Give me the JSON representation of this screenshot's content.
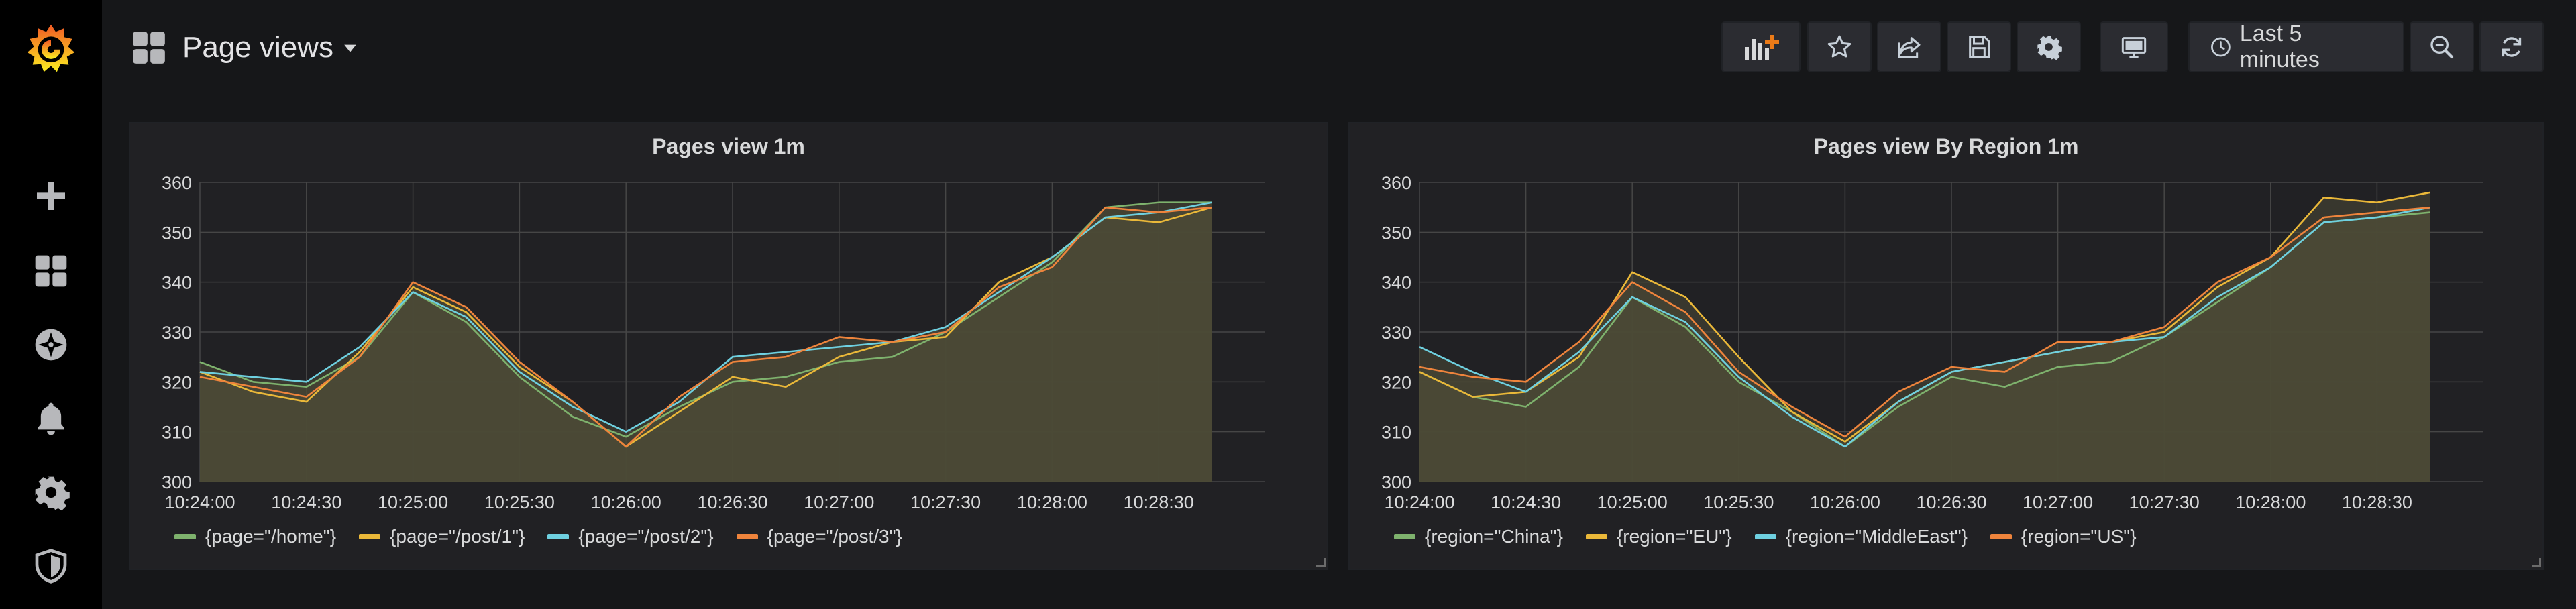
{
  "dashboard": {
    "title": "Page views"
  },
  "toolbar": {
    "time_range_label": "Last 5 minutes",
    "icons": [
      "add-panel-icon",
      "star-icon",
      "share-icon",
      "save-icon",
      "gear-icon",
      "tv-icon",
      "clock-icon",
      "zoom-out-icon",
      "refresh-icon"
    ]
  },
  "sidebar": {
    "icons": [
      "grafana-logo-icon",
      "plus-icon",
      "dashboards-grid-icon",
      "explore-compass-icon",
      "bell-icon",
      "gear-icon",
      "shield-icon"
    ]
  },
  "colors": {
    "background": "#161719",
    "panel": "#212124",
    "green": "#7eb26d",
    "yellow": "#eab839",
    "blue": "#6ed0e0",
    "orange": "#ef843c",
    "fill": "#4c4a36"
  },
  "panels": [
    {
      "title": "Pages view 1m",
      "legend": [
        "{page=\"/home\"}",
        "{page=\"/post/1\"}",
        "{page=\"/post/2\"}",
        "{page=\"/post/3\"}"
      ]
    },
    {
      "title": "Pages view By Region 1m",
      "legend": [
        "{region=\"China\"}",
        "{region=\"EU\"}",
        "{region=\"MiddleEast\"}",
        "{region=\"US\"}"
      ]
    }
  ],
  "chart_data": [
    {
      "type": "line",
      "title": "Pages view 1m",
      "ylim": [
        300,
        360
      ],
      "yticks": [
        "300",
        "310",
        "320",
        "330",
        "340",
        "350",
        "360"
      ],
      "xtick_labels": [
        "10:24:00",
        "10:24:30",
        "10:25:00",
        "10:25:30",
        "10:26:00",
        "10:26:30",
        "10:27:00",
        "10:27:30",
        "10:28:00",
        "10:28:30"
      ],
      "x": [
        "10:24:00",
        "10:24:15",
        "10:24:30",
        "10:24:45",
        "10:25:00",
        "10:25:15",
        "10:25:30",
        "10:25:45",
        "10:26:00",
        "10:26:15",
        "10:26:30",
        "10:26:45",
        "10:27:00",
        "10:27:15",
        "10:27:30",
        "10:27:45",
        "10:28:00",
        "10:28:15",
        "10:28:30",
        "10:28:45"
      ],
      "series": [
        {
          "name": "{page=\"/home\"}",
          "color": "#7eb26d",
          "values": [
            324,
            320,
            319,
            325,
            338,
            332,
            321,
            313,
            309,
            315,
            320,
            321,
            324,
            325,
            330,
            337,
            344,
            355,
            356,
            356
          ]
        },
        {
          "name": "{page=\"/post/1\"}",
          "color": "#eab839",
          "values": [
            322,
            318,
            316,
            326,
            339,
            334,
            323,
            316,
            307,
            314,
            321,
            319,
            325,
            328,
            329,
            340,
            345,
            353,
            352,
            355
          ]
        },
        {
          "name": "{page=\"/post/2\"}",
          "color": "#6ed0e0",
          "values": [
            322,
            321,
            320,
            327,
            338,
            333,
            322,
            315,
            310,
            316,
            325,
            326,
            327,
            328,
            331,
            338,
            345,
            353,
            354,
            356
          ]
        },
        {
          "name": "{page=\"/post/3\"}",
          "color": "#ef843c",
          "values": [
            321,
            319,
            317,
            325,
            340,
            335,
            324,
            316,
            307,
            317,
            324,
            325,
            329,
            328,
            330,
            339,
            343,
            355,
            354,
            355
          ]
        }
      ]
    },
    {
      "type": "line",
      "title": "Pages view By Region 1m",
      "ylim": [
        300,
        360
      ],
      "yticks": [
        "300",
        "310",
        "320",
        "330",
        "340",
        "350",
        "360"
      ],
      "xtick_labels": [
        "10:24:00",
        "10:24:30",
        "10:25:00",
        "10:25:30",
        "10:26:00",
        "10:26:30",
        "10:27:00",
        "10:27:30",
        "10:28:00",
        "10:28:30"
      ],
      "x": [
        "10:24:00",
        "10:24:15",
        "10:24:30",
        "10:24:45",
        "10:25:00",
        "10:25:15",
        "10:25:30",
        "10:25:45",
        "10:26:00",
        "10:26:15",
        "10:26:30",
        "10:26:45",
        "10:27:00",
        "10:27:15",
        "10:27:30",
        "10:27:45",
        "10:28:00",
        "10:28:15",
        "10:28:30",
        "10:28:45"
      ],
      "series": [
        {
          "name": "{region=\"China\"}",
          "color": "#7eb26d",
          "values": [
            322,
            317,
            315,
            323,
            337,
            331,
            320,
            314,
            307,
            315,
            321,
            319,
            323,
            324,
            329,
            336,
            343,
            352,
            353,
            354
          ]
        },
        {
          "name": "{region=\"EU\"}",
          "color": "#eab839",
          "values": [
            322,
            317,
            318,
            325,
            342,
            337,
            325,
            314,
            308,
            316,
            322,
            324,
            326,
            328,
            330,
            339,
            345,
            357,
            356,
            358
          ]
        },
        {
          "name": "{region=\"MiddleEast\"}",
          "color": "#6ed0e0",
          "values": [
            327,
            322,
            318,
            326,
            337,
            332,
            321,
            313,
            307,
            316,
            322,
            324,
            326,
            328,
            329,
            337,
            343,
            352,
            353,
            355
          ]
        },
        {
          "name": "{region=\"US\"}",
          "color": "#ef843c",
          "values": [
            323,
            321,
            320,
            328,
            340,
            334,
            322,
            315,
            309,
            318,
            323,
            322,
            328,
            328,
            331,
            340,
            345,
            353,
            354,
            355
          ]
        }
      ]
    }
  ]
}
